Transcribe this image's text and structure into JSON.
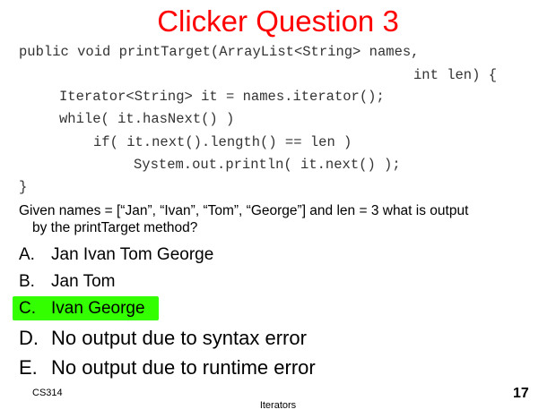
{
  "slide": {
    "title": "Clicker Question 3",
    "title_color": "#ff0000",
    "highlight_color": "#33ff00"
  },
  "code": {
    "lines": [
      "public void printTarget(ArrayList<String> names,",
      "int len) {",
      "Iterator<String> it = names.iterator();",
      "while( it.hasNext() )",
      "if( it.next().length() == len )",
      "System.out.println( it.next() );",
      "}"
    ]
  },
  "question": {
    "line1": "Given names = [“Jan”, “Ivan”, “Tom”, “George”]  and len = 3 what is output",
    "line2": "by the printTarget method?"
  },
  "options": [
    {
      "letter": "A.",
      "text": "Jan Ivan Tom George"
    },
    {
      "letter": "B.",
      "text": "Jan Tom"
    },
    {
      "letter": "C.",
      "text": "Ivan George"
    },
    {
      "letter": "D.",
      "text": "No output due to syntax error"
    },
    {
      "letter": "E.",
      "text": "No output due to runtime error"
    }
  ],
  "footer": {
    "course": "CS314",
    "topic": "Iterators",
    "page_number": "17"
  }
}
